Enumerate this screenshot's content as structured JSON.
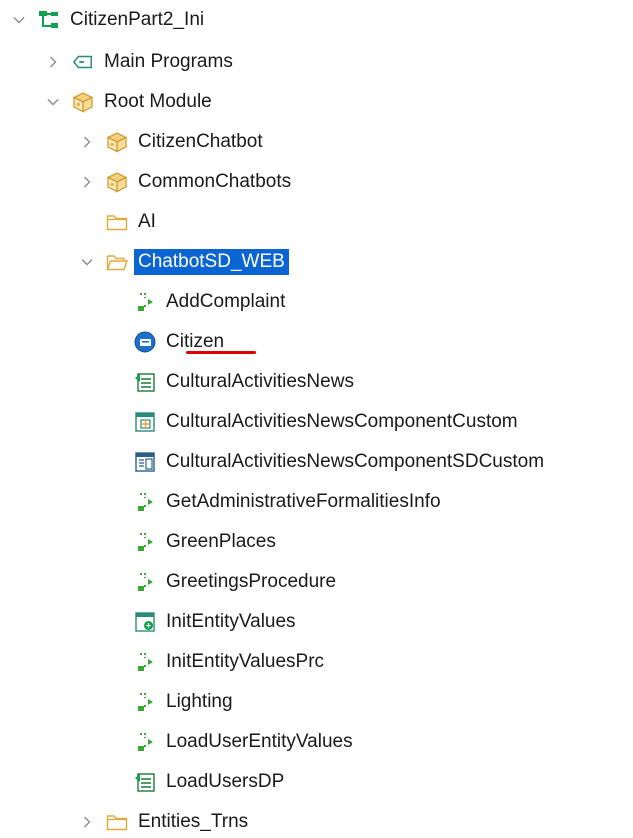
{
  "tree": {
    "root": {
      "label": "CitizenPart2_Ini",
      "icon": "kb-tree-icon",
      "expanded": true
    },
    "main_programs": {
      "label": "Main Programs",
      "icon": "tag-icon",
      "expanded": false
    },
    "root_module": {
      "label": "Root Module",
      "icon": "module-package-icon",
      "expanded": true
    },
    "citizen_chatbot": {
      "label": "CitizenChatbot",
      "icon": "module-package-icon",
      "expanded": false
    },
    "common_chatbots": {
      "label": "CommonChatbots",
      "icon": "module-package-icon",
      "expanded": false
    },
    "ai": {
      "label": "AI",
      "icon": "folder-icon"
    },
    "chatbot_sd_web": {
      "label": "ChatbotSD_WEB",
      "icon": "folder-open-icon",
      "expanded": true,
      "selected": true
    },
    "children": [
      {
        "label": "AddComplaint",
        "icon": "procedure-icon"
      },
      {
        "label": "Citizen",
        "icon": "sd-panel-icon",
        "underlined": true
      },
      {
        "label": "CulturalActivitiesNews",
        "icon": "data-provider-icon"
      },
      {
        "label": "CulturalActivitiesNewsComponentCustom",
        "icon": "web-component-icon"
      },
      {
        "label": "CulturalActivitiesNewsComponentSDCustom",
        "icon": "sd-component-icon"
      },
      {
        "label": "GetAdministrativeFormalitiesInfo",
        "icon": "procedure-icon"
      },
      {
        "label": "GreenPlaces",
        "icon": "procedure-icon"
      },
      {
        "label": "GreetingsProcedure",
        "icon": "procedure-icon"
      },
      {
        "label": "InitEntityValues",
        "icon": "web-panel-icon"
      },
      {
        "label": "InitEntityValuesPrc",
        "icon": "procedure-icon"
      },
      {
        "label": "Lighting",
        "icon": "procedure-icon"
      },
      {
        "label": "LoadUserEntityValues",
        "icon": "procedure-icon"
      },
      {
        "label": "LoadUsersDP",
        "icon": "data-provider-icon"
      }
    ],
    "entities_trns": {
      "label": "Entities_Trns",
      "icon": "folder-icon",
      "expanded": false
    }
  },
  "colors": {
    "selection": "#0a64d2",
    "underline": "#e00000",
    "kb_green": "#12a150",
    "folder": "#e8b84a",
    "procedure_green": "#3aa635",
    "teal": "#2b8a7a"
  }
}
